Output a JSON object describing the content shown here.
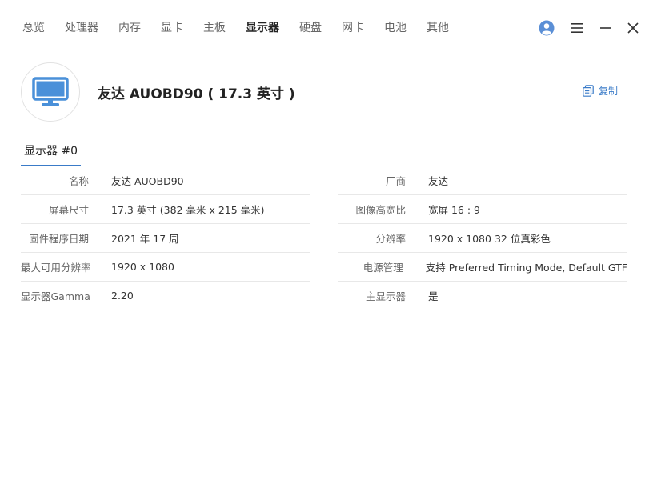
{
  "nav": {
    "items": [
      {
        "label": "总览"
      },
      {
        "label": "处理器"
      },
      {
        "label": "内存"
      },
      {
        "label": "显卡"
      },
      {
        "label": "主板"
      },
      {
        "label": "显示器"
      },
      {
        "label": "硬盘"
      },
      {
        "label": "网卡"
      },
      {
        "label": "电池"
      },
      {
        "label": "其他"
      }
    ],
    "active_index": 5
  },
  "window_controls": {
    "icons": [
      "user-avatar-icon",
      "hamburger-menu-icon",
      "minimize-icon",
      "close-icon"
    ]
  },
  "device": {
    "icon": "monitor-icon",
    "title": "友达 AUOBD90 ( 17.3 英寸 )",
    "copy_label": "复制",
    "copy_icon": "copy-icon"
  },
  "tabs": [
    {
      "label": "显示器 #0"
    }
  ],
  "info_left": [
    {
      "label": "名称",
      "value": "友达 AUOBD90"
    },
    {
      "label": "屏幕尺寸",
      "value": "17.3 英寸 (382 毫米 x 215 毫米)"
    },
    {
      "label": "固件程序日期",
      "value": "2021 年 17 周"
    },
    {
      "label": "最大可用分辨率",
      "value": "1920 x 1080"
    },
    {
      "label": "显示器Gamma",
      "value": "2.20"
    }
  ],
  "info_right": [
    {
      "label": "厂商",
      "value": "友达"
    },
    {
      "label": "图像高宽比",
      "value": "宽屏 16 : 9"
    },
    {
      "label": "分辨率",
      "value": "1920 x 1080 32 位真彩色"
    },
    {
      "label": "电源管理",
      "value": "支持 Preferred Timing Mode, Default GTF"
    },
    {
      "label": "主显示器",
      "value": "是"
    }
  ],
  "colors": {
    "accent": "#3a7bc8",
    "icon_blue": "#4a90d9"
  }
}
